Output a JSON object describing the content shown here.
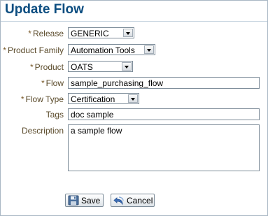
{
  "dialog": {
    "title": "Update Flow"
  },
  "required_marker": "*",
  "fields": {
    "release": {
      "label": "Release",
      "value": "GENERIC"
    },
    "product_family": {
      "label": "Product Family",
      "value": "Automation Tools"
    },
    "product": {
      "label": "Product",
      "value": "OATS"
    },
    "flow": {
      "label": "Flow",
      "value": "sample_purchasing_flow"
    },
    "flow_type": {
      "label": "Flow Type",
      "value": "Certification"
    },
    "tags": {
      "label": "Tags",
      "value": "doc sample"
    },
    "description": {
      "label": "Description",
      "value": "a sample flow"
    }
  },
  "buttons": {
    "save": "Save",
    "cancel": "Cancel"
  },
  "colors": {
    "title": "#0c4d80",
    "label": "#5a4a2a",
    "border": "#7d8c99"
  },
  "icons": {
    "save": "floppy-disk-icon",
    "cancel": "undo-arrow-icon"
  }
}
